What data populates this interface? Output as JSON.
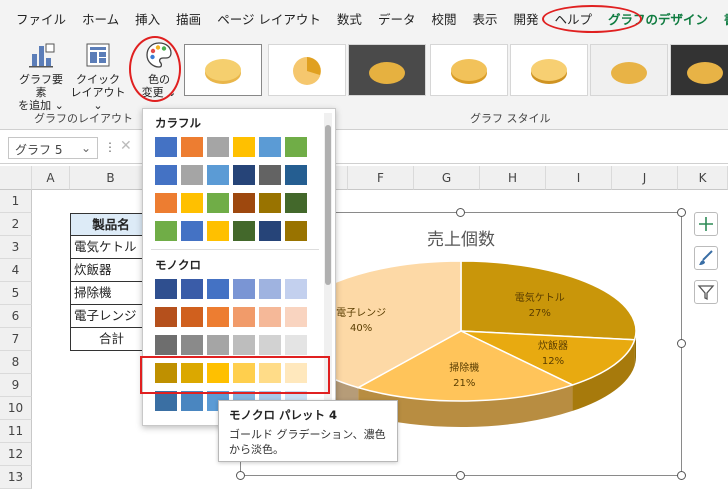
{
  "menu": {
    "items": [
      "ファイル",
      "ホーム",
      "挿入",
      "描画",
      "ページ レイアウト",
      "数式",
      "データ",
      "校閲",
      "表示",
      "開発",
      "ヘルプ",
      "グラフのデザイン",
      "書式"
    ]
  },
  "ribbon": {
    "add_element": "グラフ要素\nを追加 ⌄",
    "add_element_1": "グラフ要素",
    "add_element_2": "を追加 ⌄",
    "quick_layout_1": "クイック",
    "quick_layout_2": "レイアウト ⌄",
    "layout_group": "グラフのレイアウト",
    "color_btn_1": "色の",
    "color_btn_2": "変更 ⌄",
    "styles_group": "グラフ スタイル"
  },
  "namebox": "グラフ 5",
  "columns": [
    "A",
    "B",
    "C",
    "D",
    "E",
    "F",
    "G",
    "H",
    "I",
    "J",
    "K"
  ],
  "rows": [
    "1",
    "2",
    "3",
    "4",
    "5",
    "6",
    "7",
    "8",
    "9",
    "10",
    "11",
    "12",
    "13"
  ],
  "table": {
    "header": "製品名",
    "items": [
      "電気ケトル",
      "炊飯器",
      "掃除機",
      "電子レンジ"
    ],
    "total": "合計"
  },
  "chart_data": {
    "type": "pie",
    "title": "売上個数",
    "categories": [
      "電気ケトル",
      "炊飯器",
      "掃除機",
      "電子レンジ"
    ],
    "values": [
      27,
      12,
      21,
      40
    ],
    "labels": [
      "27%",
      "12%",
      "21%",
      "40%"
    ],
    "colors": [
      "#c9960a",
      "#e8aa10",
      "#ffc45a",
      "#fdd9a6"
    ]
  },
  "dropdown": {
    "colorful_title": "カラフル",
    "mono_title": "モノクロ",
    "colorful_rows": [
      [
        "#4472c4",
        "#ed7d31",
        "#a5a5a5",
        "#ffc000",
        "#5b9bd5",
        "#70ad47"
      ],
      [
        "#4472c4",
        "#a5a5a5",
        "#5b9bd5",
        "#264478",
        "#636363",
        "#255e91"
      ],
      [
        "#ed7d31",
        "#ffc000",
        "#70ad47",
        "#9e480e",
        "#997300",
        "#43682b"
      ],
      [
        "#70ad47",
        "#4472c4",
        "#ffc000",
        "#43682b",
        "#264478",
        "#997300"
      ]
    ],
    "mono_rows": [
      [
        "#2f4f8f",
        "#3a5ca8",
        "#4472c4",
        "#7a95d4",
        "#9fb3e0",
        "#c3d0ee"
      ],
      [
        "#b5501c",
        "#d0601e",
        "#ed7d31",
        "#f19b6a",
        "#f5b898",
        "#f9d4c0"
      ],
      [
        "#6e6e6e",
        "#8a8a8a",
        "#a5a5a5",
        "#bdbdbd",
        "#d2d2d2",
        "#e4e4e4"
      ],
      [
        "#bf9000",
        "#dba800",
        "#ffc000",
        "#ffcf4d",
        "#ffdc88",
        "#ffe8bd"
      ],
      [
        "#3a6fa3",
        "#4a86c0",
        "#5b9bd5",
        "#86b5e0",
        "#a8c9ea",
        "#cadff3"
      ]
    ]
  },
  "tooltip": {
    "title": "モノクロ パレット 4",
    "desc": "ゴールド グラデーション、濃色から淡色。"
  }
}
